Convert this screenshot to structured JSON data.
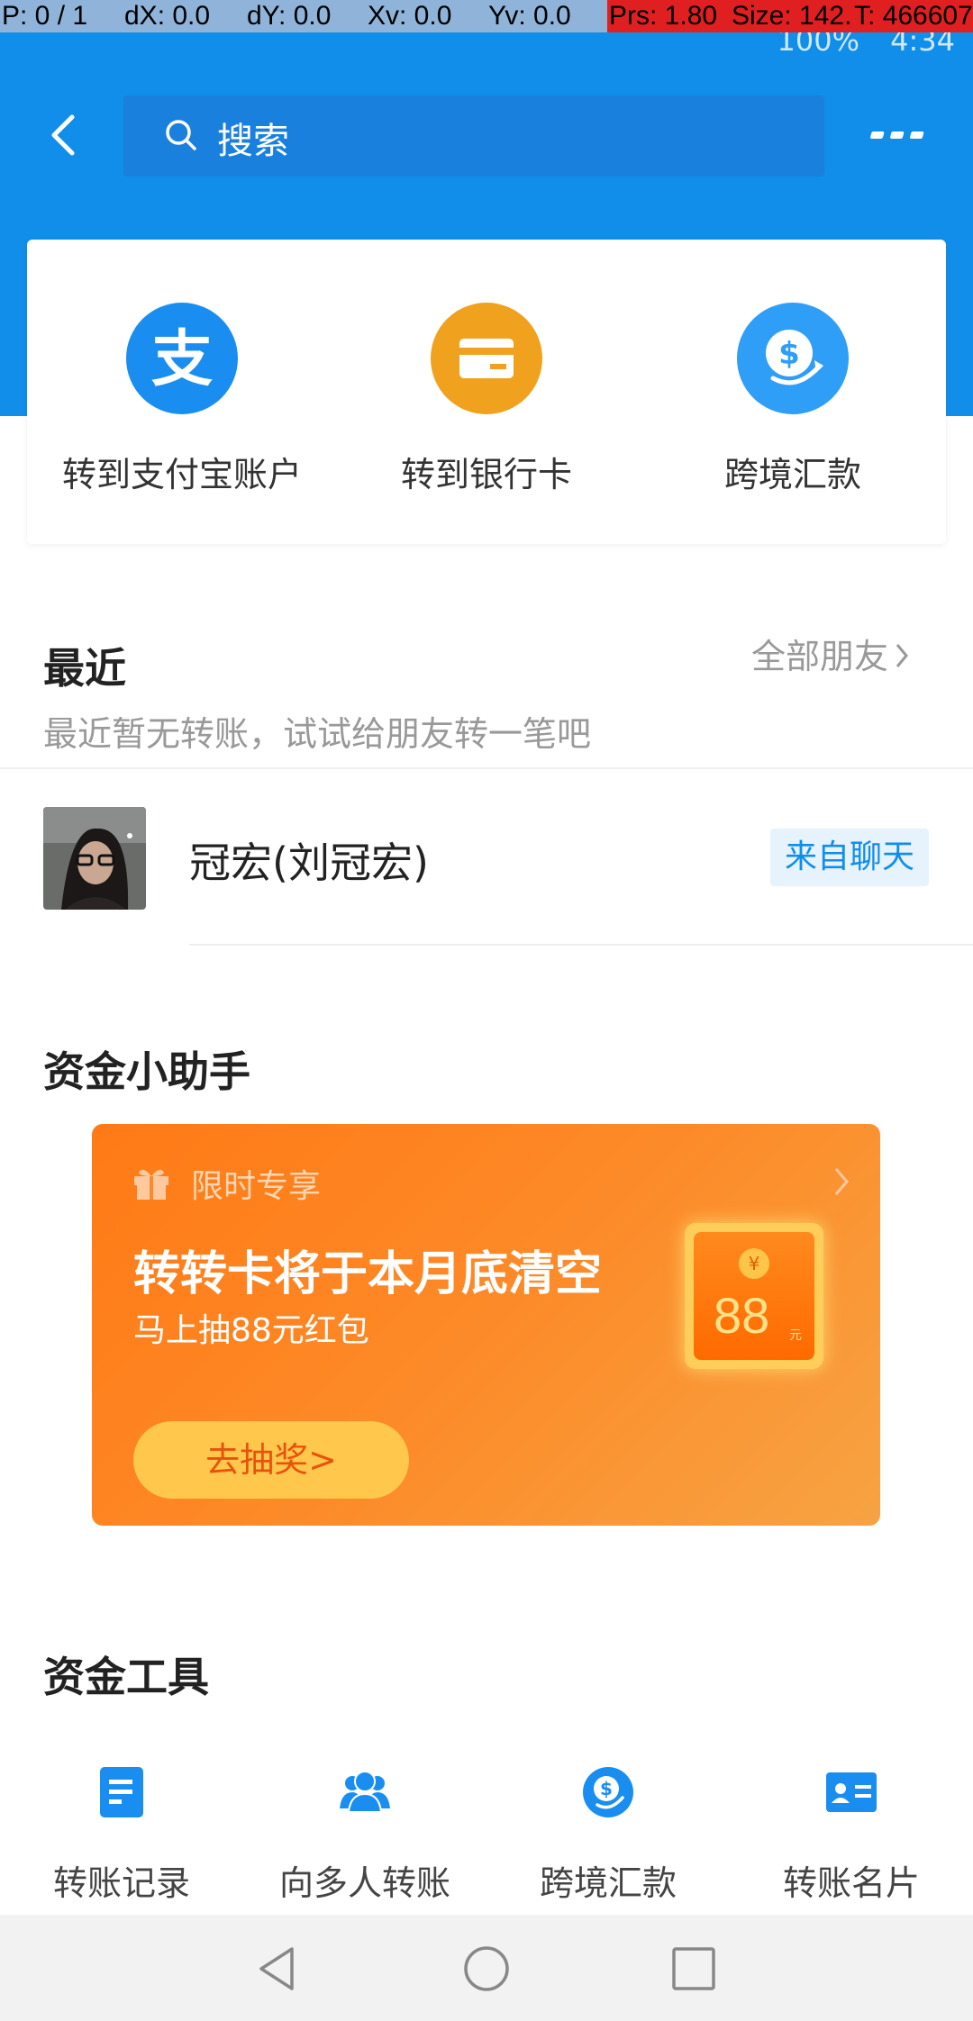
{
  "debug": {
    "p": "P: 0 / 1",
    "dx": "dX: 0.0",
    "dy": "dY: 0.0",
    "xv": "Xv: 0.0",
    "yv": "Yv: 0.0",
    "prs": "Prs: 1.80",
    "size": "Size: 142.",
    "t": "T: 466607"
  },
  "status": {
    "battery": "100%",
    "time": "4:34"
  },
  "header": {
    "search_placeholder": "搜索"
  },
  "transfer_options": [
    {
      "label": "转到支付宝账户",
      "icon": "alipay-icon",
      "color": "#1a8ef0"
    },
    {
      "label": "转到银行卡",
      "icon": "bank-card-icon",
      "color": "#f0a21e"
    },
    {
      "label": "跨境汇款",
      "icon": "cross-border-icon",
      "color": "#2f9ef7"
    }
  ],
  "recent": {
    "title": "最近",
    "all_friends": "全部朋友",
    "subtitle": "最近暂无转账，试试给朋友转一笔吧",
    "contacts": [
      {
        "name": "冠宏(刘冠宏)",
        "tag": "来自聊天"
      }
    ]
  },
  "assistant": {
    "title": "资金小助手",
    "promo": {
      "tag": "限时专享",
      "title": "转转卡将于本月底清空",
      "subtitle": "马上抽88元红包",
      "button": "去抽奖>",
      "coin": "¥",
      "amount": "88",
      "unit": "元"
    }
  },
  "tools": {
    "title": "资金工具",
    "items": [
      {
        "label": "转账记录",
        "icon": "record-icon"
      },
      {
        "label": "向多人转账",
        "icon": "group-icon"
      },
      {
        "label": "跨境汇款",
        "icon": "cross-border-icon"
      },
      {
        "label": "转账名片",
        "icon": "card-icon"
      }
    ]
  },
  "colors": {
    "brand": "#108ee9",
    "promo": "#ff7a16"
  }
}
